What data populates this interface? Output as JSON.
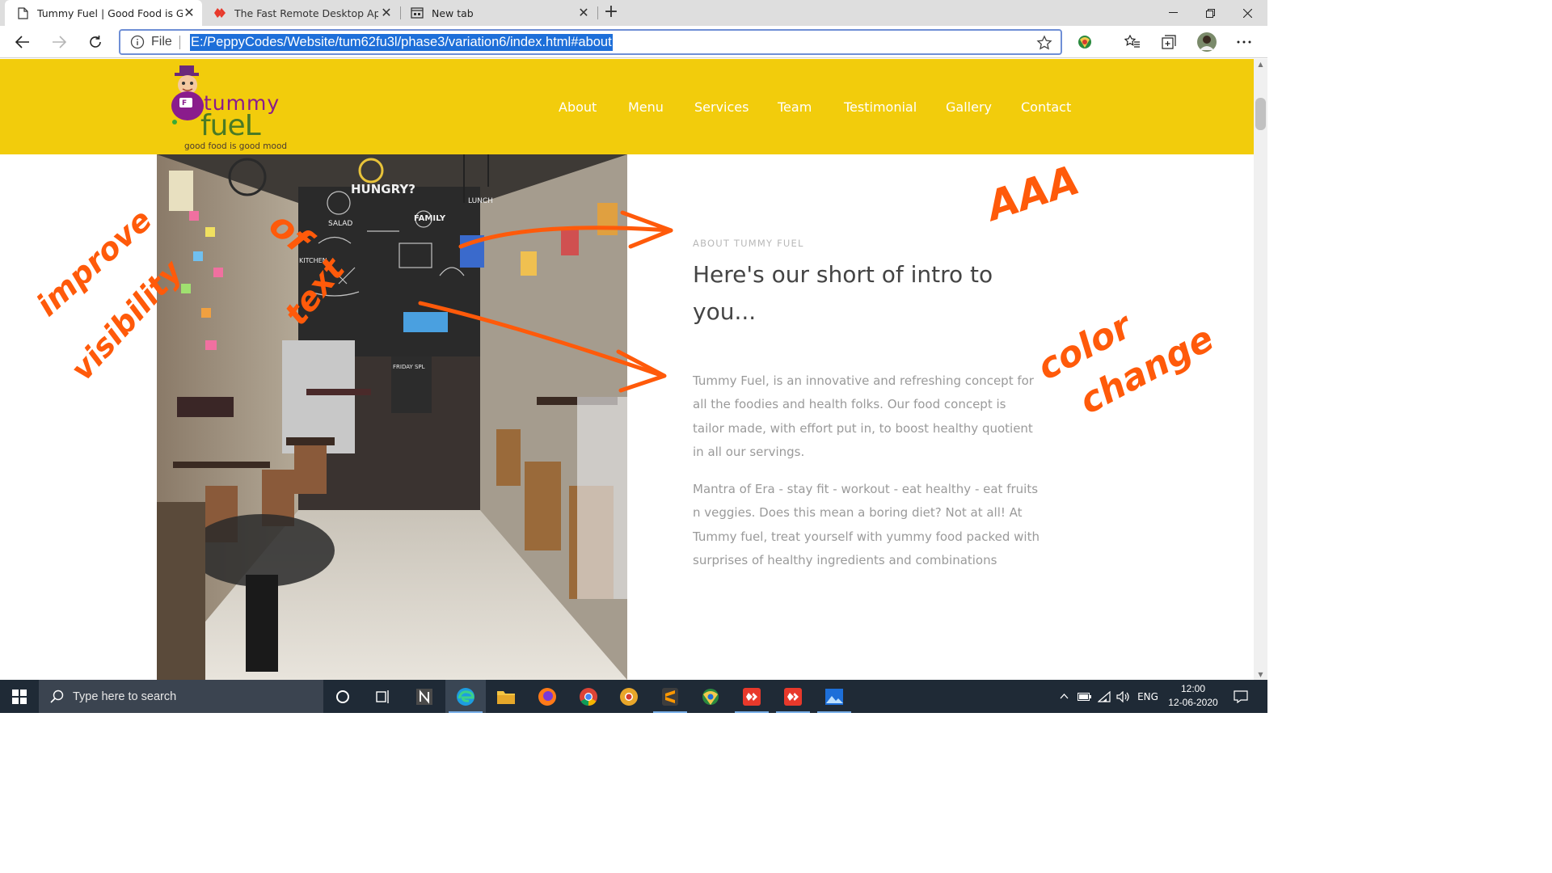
{
  "browser": {
    "tabs": [
      {
        "title": "Tummy Fuel | Good Food is Good Mood",
        "close": "✕",
        "icon": "page-icon"
      },
      {
        "title": "The Fast Remote Desktop Application",
        "close": "✕",
        "icon": "anydesk-icon"
      },
      {
        "title": "New tab",
        "close": "✕",
        "icon": "newtab-icon"
      }
    ],
    "new_tab_glyph": "+",
    "window_controls": {
      "minimize": "—",
      "restore": "❐",
      "close": "✕"
    },
    "address_bar": {
      "scheme_label": "File",
      "url": "E:/PeppyCodes/Website/tum62fu3l/phase3/variation6/index.html#about"
    }
  },
  "site": {
    "logo": {
      "word1": "tummy",
      "word2": "fueL",
      "tagline": "good food is good mood",
      "badge": "F"
    },
    "nav": [
      "About",
      "Menu",
      "Services",
      "Team",
      "Testimonial",
      "Gallery",
      "Contact"
    ],
    "about": {
      "kicker": "ABOUT TUMMY FUEL",
      "heading": "Here's our short of intro to you...",
      "paragraphs": [
        "Tummy Fuel, is an innovative and refreshing concept for all the foodies and health folks. Our food concept is tailor made, with effort put in, to boost healthy quotient in all our servings.",
        "Mantra of Era - stay fit - workout - eat healthy - eat fruits n veggies. Does this mean a boring diet? Not at all! At Tummy fuel, treat yourself with yummy food packed with surprises of healthy ingredients and combinations"
      ],
      "photo_text": {
        "board1": "HUNGRY?",
        "board2": "FAMILY",
        "board3": "SALAD",
        "board4": "FRIDAY SPL",
        "board5": "KITCHEN",
        "board6": "LUNCH"
      }
    },
    "colors": {
      "header": "#f2cc0c",
      "annotation": "#ff5a0a"
    }
  },
  "annotations": {
    "a1": "improve",
    "a2": "visibility",
    "a3": "of",
    "a4": "text",
    "a5": "AAA",
    "a6": "color",
    "a7": "change"
  },
  "taskbar": {
    "search_placeholder": "Type here to search",
    "language": "ENG",
    "time": "12:00",
    "date": "12-06-2020"
  }
}
